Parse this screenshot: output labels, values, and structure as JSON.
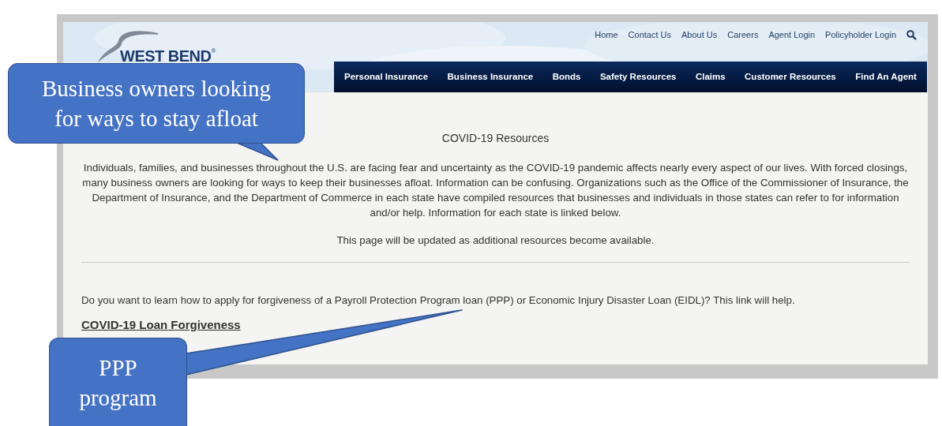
{
  "header": {
    "logo": {
      "text": "WEST BEND",
      "mark": "®"
    },
    "utility_links": [
      "Home",
      "Contact Us",
      "About Us",
      "Careers",
      "Agent Login",
      "Policyholder Login"
    ],
    "nav": [
      "Personal Insurance",
      "Business Insurance",
      "Bonds",
      "Safety Resources",
      "Claims",
      "Customer Resources",
      "Find An Agent"
    ]
  },
  "content": {
    "title": "COVID-19 Resources",
    "paragraph": "Individuals, families, and businesses throughout the U.S. are facing fear and uncertainty as the COVID-19 pandemic affects nearly every aspect of our lives. With forced closings, many business owners are looking for ways to keep their businesses afloat. Information can be confusing. Organizations such as the Office of the Commissioner of Insurance, the Department of Insurance, and the Department of Commerce in each state have compiled resources that businesses and individuals in those states can refer to for information and/or help. Information for each state is linked below.",
    "update_note": "This page will be updated as additional resources become available.",
    "question": "Do you want to learn how to apply for forgiveness of a Payroll Protection Program loan (PPP) or Economic Injury Disaster Loan (EIDL)? This link will help.",
    "link": "COVID-19 Loan Forgiveness"
  },
  "callouts": [
    {
      "text": "Business owners looking for ways to stay afloat"
    },
    {
      "text": "PPP program"
    }
  ]
}
